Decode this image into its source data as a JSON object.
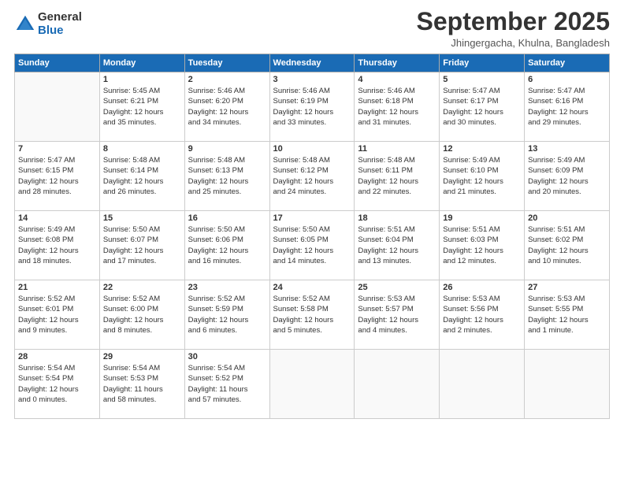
{
  "logo": {
    "general": "General",
    "blue": "Blue"
  },
  "title": "September 2025",
  "location": "Jhingergacha, Khulna, Bangladesh",
  "days_header": [
    "Sunday",
    "Monday",
    "Tuesday",
    "Wednesday",
    "Thursday",
    "Friday",
    "Saturday"
  ],
  "weeks": [
    [
      {
        "day": "",
        "info": ""
      },
      {
        "day": "1",
        "info": "Sunrise: 5:45 AM\nSunset: 6:21 PM\nDaylight: 12 hours\nand 35 minutes."
      },
      {
        "day": "2",
        "info": "Sunrise: 5:46 AM\nSunset: 6:20 PM\nDaylight: 12 hours\nand 34 minutes."
      },
      {
        "day": "3",
        "info": "Sunrise: 5:46 AM\nSunset: 6:19 PM\nDaylight: 12 hours\nand 33 minutes."
      },
      {
        "day": "4",
        "info": "Sunrise: 5:46 AM\nSunset: 6:18 PM\nDaylight: 12 hours\nand 31 minutes."
      },
      {
        "day": "5",
        "info": "Sunrise: 5:47 AM\nSunset: 6:17 PM\nDaylight: 12 hours\nand 30 minutes."
      },
      {
        "day": "6",
        "info": "Sunrise: 5:47 AM\nSunset: 6:16 PM\nDaylight: 12 hours\nand 29 minutes."
      }
    ],
    [
      {
        "day": "7",
        "info": "Sunrise: 5:47 AM\nSunset: 6:15 PM\nDaylight: 12 hours\nand 28 minutes."
      },
      {
        "day": "8",
        "info": "Sunrise: 5:48 AM\nSunset: 6:14 PM\nDaylight: 12 hours\nand 26 minutes."
      },
      {
        "day": "9",
        "info": "Sunrise: 5:48 AM\nSunset: 6:13 PM\nDaylight: 12 hours\nand 25 minutes."
      },
      {
        "day": "10",
        "info": "Sunrise: 5:48 AM\nSunset: 6:12 PM\nDaylight: 12 hours\nand 24 minutes."
      },
      {
        "day": "11",
        "info": "Sunrise: 5:48 AM\nSunset: 6:11 PM\nDaylight: 12 hours\nand 22 minutes."
      },
      {
        "day": "12",
        "info": "Sunrise: 5:49 AM\nSunset: 6:10 PM\nDaylight: 12 hours\nand 21 minutes."
      },
      {
        "day": "13",
        "info": "Sunrise: 5:49 AM\nSunset: 6:09 PM\nDaylight: 12 hours\nand 20 minutes."
      }
    ],
    [
      {
        "day": "14",
        "info": "Sunrise: 5:49 AM\nSunset: 6:08 PM\nDaylight: 12 hours\nand 18 minutes."
      },
      {
        "day": "15",
        "info": "Sunrise: 5:50 AM\nSunset: 6:07 PM\nDaylight: 12 hours\nand 17 minutes."
      },
      {
        "day": "16",
        "info": "Sunrise: 5:50 AM\nSunset: 6:06 PM\nDaylight: 12 hours\nand 16 minutes."
      },
      {
        "day": "17",
        "info": "Sunrise: 5:50 AM\nSunset: 6:05 PM\nDaylight: 12 hours\nand 14 minutes."
      },
      {
        "day": "18",
        "info": "Sunrise: 5:51 AM\nSunset: 6:04 PM\nDaylight: 12 hours\nand 13 minutes."
      },
      {
        "day": "19",
        "info": "Sunrise: 5:51 AM\nSunset: 6:03 PM\nDaylight: 12 hours\nand 12 minutes."
      },
      {
        "day": "20",
        "info": "Sunrise: 5:51 AM\nSunset: 6:02 PM\nDaylight: 12 hours\nand 10 minutes."
      }
    ],
    [
      {
        "day": "21",
        "info": "Sunrise: 5:52 AM\nSunset: 6:01 PM\nDaylight: 12 hours\nand 9 minutes."
      },
      {
        "day": "22",
        "info": "Sunrise: 5:52 AM\nSunset: 6:00 PM\nDaylight: 12 hours\nand 8 minutes."
      },
      {
        "day": "23",
        "info": "Sunrise: 5:52 AM\nSunset: 5:59 PM\nDaylight: 12 hours\nand 6 minutes."
      },
      {
        "day": "24",
        "info": "Sunrise: 5:52 AM\nSunset: 5:58 PM\nDaylight: 12 hours\nand 5 minutes."
      },
      {
        "day": "25",
        "info": "Sunrise: 5:53 AM\nSunset: 5:57 PM\nDaylight: 12 hours\nand 4 minutes."
      },
      {
        "day": "26",
        "info": "Sunrise: 5:53 AM\nSunset: 5:56 PM\nDaylight: 12 hours\nand 2 minutes."
      },
      {
        "day": "27",
        "info": "Sunrise: 5:53 AM\nSunset: 5:55 PM\nDaylight: 12 hours\nand 1 minute."
      }
    ],
    [
      {
        "day": "28",
        "info": "Sunrise: 5:54 AM\nSunset: 5:54 PM\nDaylight: 12 hours\nand 0 minutes."
      },
      {
        "day": "29",
        "info": "Sunrise: 5:54 AM\nSunset: 5:53 PM\nDaylight: 11 hours\nand 58 minutes."
      },
      {
        "day": "30",
        "info": "Sunrise: 5:54 AM\nSunset: 5:52 PM\nDaylight: 11 hours\nand 57 minutes."
      },
      {
        "day": "",
        "info": ""
      },
      {
        "day": "",
        "info": ""
      },
      {
        "day": "",
        "info": ""
      },
      {
        "day": "",
        "info": ""
      }
    ]
  ]
}
